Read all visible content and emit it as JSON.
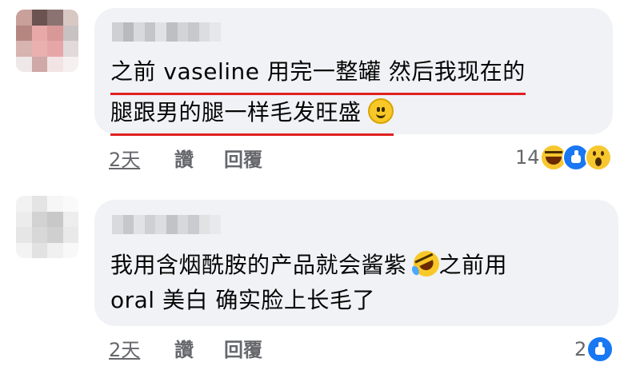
{
  "comments": [
    {
      "text_line1": "之前 vaseline 用完一整罐  然后我现在的",
      "text_line2": "腿跟男的腿一样毛发旺盛",
      "emoji": "slightly-smiling-face-icon",
      "time": "2天",
      "like_label": "讚",
      "reply_label": "回覆",
      "reaction_count": "14",
      "reactions": [
        "haha-icon",
        "like-icon",
        "wow-icon"
      ]
    },
    {
      "text_line1": "我用含烟酰胺的产品就会酱紫",
      "text_line1_after": "之前用",
      "text_line2": "oral 美白  确实脸上长毛了",
      "emoji": "rolling-on-floor-laughing-icon",
      "time": "2天",
      "like_label": "讚",
      "reply_label": "回覆",
      "reaction_count": "2",
      "reactions": [
        "like-icon"
      ]
    }
  ],
  "colors": {
    "bubble": "#f0f2f5",
    "underline": "#e02020",
    "meta_text": "#65676b",
    "like_blue": "#1877f2",
    "reaction_yellow": "#f7c72f"
  }
}
